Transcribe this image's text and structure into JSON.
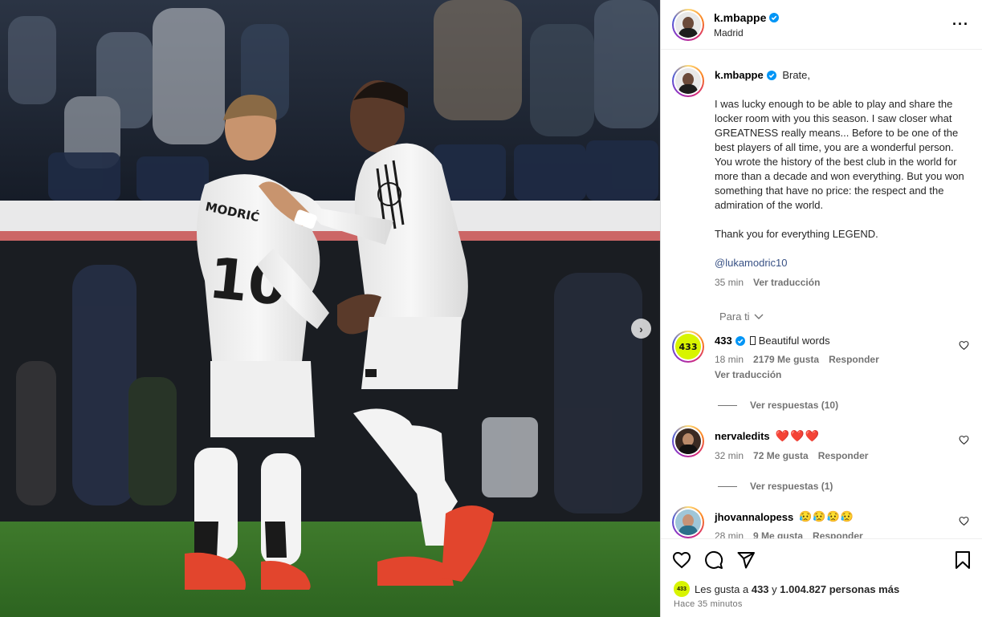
{
  "post": {
    "username": "k.mbappe",
    "location": "Madrid",
    "more_icon": "more-horizontal-icon",
    "caption": {
      "greeting": "Brate,",
      "paragraph1": "I was lucky enough to be able to play and share the locker room with you this season. I saw closer what GREATNESS really means... Before to be one of the best players of all time, you are a wonderful person. You wrote the history of the best club in the world for more than a decade and won everything. But you won something that have no price: the respect and the admiration of the world.",
      "paragraph2": "Thank you for everything LEGEND.",
      "mention": "@lukamodric10",
      "time": "35 min",
      "translate": "Ver traducción"
    },
    "for_you": "Para ti",
    "comments": [
      {
        "username": "433",
        "avatar_text": "433",
        "text": "Beautiful words",
        "time": "18 min",
        "likes": "2179 Me gusta",
        "reply": "Responder",
        "translate": "Ver traducción",
        "view_replies": "Ver respuestas (10)"
      },
      {
        "username": "nervaledits",
        "text": "❤️❤️❤️",
        "time": "32 min",
        "likes": "72 Me gusta",
        "reply": "Responder",
        "view_replies": "Ver respuestas (1)"
      },
      {
        "username": "jhovannalopess",
        "text": "😥😥😥😥",
        "time": "28 min",
        "likes": "9 Me gusta",
        "reply": "Responder"
      }
    ],
    "likes_line": {
      "prefix": "Les gusta a",
      "first": "433",
      "middle": "y",
      "rest": "1.004.827 personas más"
    },
    "posted_ago": "Hace 35 minutos",
    "colors": {
      "verified": "#0095f6",
      "panel_bg": "#ffffff",
      "muted": "#737373",
      "mention": "#385185",
      "brand_433": "#d8f400"
    }
  }
}
